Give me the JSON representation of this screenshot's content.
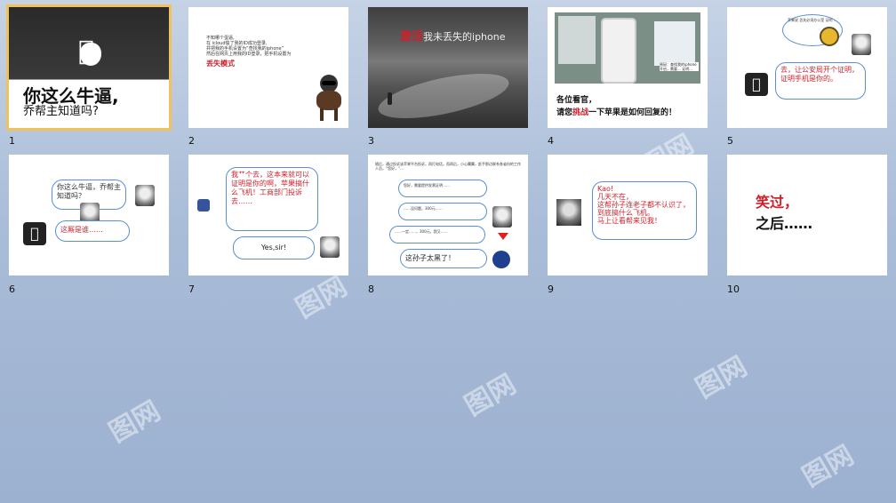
{
  "slides": [
    {
      "number": "1",
      "title": "你这么牛逼,",
      "subtitle": "乔帮主知道吗?"
    },
    {
      "number": "2",
      "lines": [
        "不知哪个蛋逼,",
        "在 icloud偷了我的ID成功登录,",
        "并把我的手机设置为“查找我的iphone”",
        "然后在网页上用我的ID登录，把手机设置为"
      ],
      "highlight": "丢失模式"
    },
    {
      "number": "3",
      "title_a": "激活",
      "title_b": "我未丢失的iphone"
    },
    {
      "number": "4",
      "caption_a": "各位看官，",
      "caption_b": "请您",
      "caption_c": "挑战",
      "caption_d": "一下苹果是如何回复的！",
      "photo_text": "原因：查找我的iphone 开启，需要... 证明..."
    },
    {
      "number": "5",
      "bubble1": "苹果说 丢失必须办公室 证明 ...",
      "bubble2": "去，让公安局开个证明，证明手机是你的。"
    },
    {
      "number": "6",
      "bubble1": "你这么牛逼，乔帮主知道吗？",
      "bubble2": "这厮是谁……"
    },
    {
      "number": "7",
      "bubble1": "我艹个去，这本来就可以证明是你的啊，苹果搞什么飞机！工商部门投诉去……",
      "bubble2": "Yes,sir!"
    },
    {
      "number": "8",
      "intro": "随后，通过投诉该苹果平台投诉，再打电话，而再后，小心翼翼，赶手那边联系各省份的工作人员，“您好，”...",
      "b1": "您好，需要提供发票证明……",
      "b2": "……没问题，300元……",
      "b3": "……一定……，300元，我又……",
      "b4": "这孙子太黑了！"
    },
    {
      "number": "9",
      "lines": [
        "Kao!",
        "几天不在，",
        "这帮孙子连老子都不认识了，",
        "到底搞什么飞机。",
        "马上让看帮来见我！"
      ]
    },
    {
      "number": "10",
      "line1": "笑过，",
      "line2": "之后……"
    }
  ],
  "watermark": "图网",
  "colors": {
    "accent_red": "#d0202a",
    "bubble_border": "#5a8fd0",
    "selected_outline": "#f2c25a"
  }
}
